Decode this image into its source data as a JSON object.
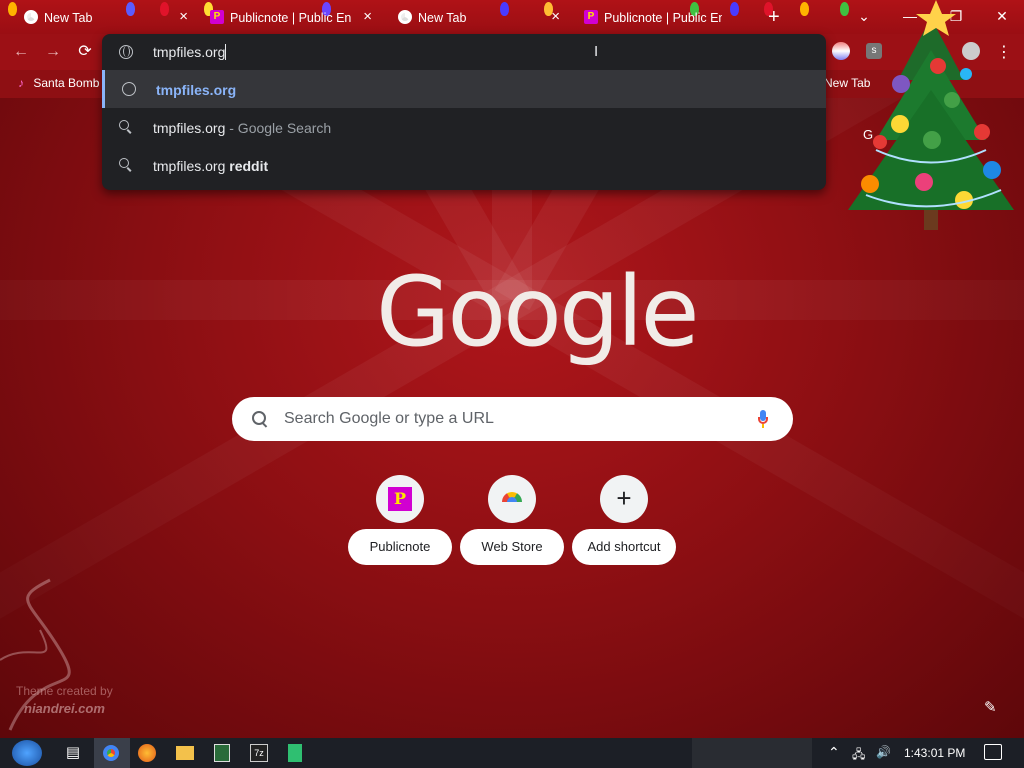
{
  "tabs": [
    {
      "title": "New Tab",
      "icon": "chrome-icon"
    },
    {
      "title": "Publicnote | Public En",
      "icon": "publicnote-icon"
    },
    {
      "title": "New Tab",
      "icon": "chrome-icon"
    },
    {
      "title": "Publicnote | Public En",
      "icon": "publicnote-icon"
    }
  ],
  "new_tab_symbol": "+",
  "close_symbol": "×",
  "window_controls": {
    "dropdown": "⌄",
    "minimize": "—",
    "restore": "❐",
    "close": "✕"
  },
  "nav": {
    "back": "←",
    "forward": "→",
    "reload": "⟳"
  },
  "omnibox": {
    "value": "tmpfiles.org",
    "suggestions": [
      {
        "text": "tmpfiles.org",
        "suffix": "",
        "bold": "",
        "icon": "globe-icon",
        "selected": true
      },
      {
        "text": "tmpfiles.org",
        "suffix": " - Google Search",
        "bold": "",
        "icon": "search-icon",
        "selected": false
      },
      {
        "text": "tmpfiles.org ",
        "suffix": "",
        "bold": "reddit",
        "icon": "search-icon",
        "selected": false
      }
    ]
  },
  "bookmarks": {
    "left": "Santa Bomb",
    "right": "New Tab"
  },
  "partial_right_text": "G",
  "logo_text": "Google",
  "search": {
    "placeholder": "Search Google or type a URL"
  },
  "shortcuts": [
    {
      "label": "Publicnote",
      "icon": "publicnote-icon",
      "glyph": "P"
    },
    {
      "label": "Web Store",
      "icon": "webstore-icon",
      "glyph": ""
    },
    {
      "label": "Add shortcut",
      "icon": "plus-icon",
      "glyph": "+"
    }
  ],
  "theme_credit": {
    "line1": "Theme created by",
    "line2": "niandrei.com"
  },
  "customize_icon": "✎",
  "taskbar": {
    "clock": "1:43:01 PM"
  },
  "colors": {
    "accent": "#8ab4f8",
    "omnibox_bg": "#202124",
    "theme_red": "#9c1015"
  }
}
